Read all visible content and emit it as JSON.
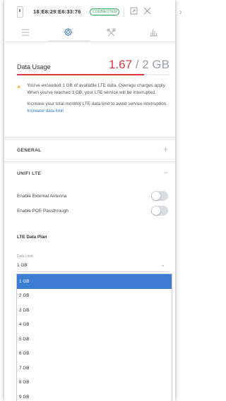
{
  "device": {
    "mac": "18:E8:29:E6:33:76",
    "status": "CONNECTED"
  },
  "tabs": [
    {
      "name": "list",
      "icon": "list-icon"
    },
    {
      "name": "settings",
      "icon": "gear-icon",
      "active": true
    },
    {
      "name": "tools",
      "icon": "tools-icon"
    },
    {
      "name": "statistics",
      "icon": "bar-chart-icon"
    }
  ],
  "usage": {
    "label": "Data Usage",
    "used": "1.67",
    "separator": "/",
    "limit": "2 GB",
    "fraction": 0.835,
    "warning_main": "You've exceeded 1 GB of available LTE data. Overage charges apply. When you've reached 3 GB, your LTE service will be interrupted.",
    "warning_second": "Increase your total monthly LTE data limit to avoid service interruption.",
    "warning_link": "Increase data limit"
  },
  "sections": {
    "general": {
      "title": "GENERAL",
      "toggle": "+"
    },
    "unifi_lte": {
      "title": "UNIFI LTE",
      "toggle": "−"
    }
  },
  "lte": {
    "external_antenna_label": "Enable External Antenna",
    "poe_passthrough_label": "Enable POE Passthrough",
    "plan_title": "LTE Data Plan",
    "data_limit_label": "Data Limit",
    "selected_value": "1 GB",
    "options": [
      "1 GB",
      "2 GB",
      "3 GB",
      "4 GB",
      "5 GB",
      "6 GB",
      "7 GB",
      "8 GB",
      "9 GB"
    ]
  },
  "colors": {
    "accent_red": "#e03744",
    "link_blue": "#2b7fce",
    "selected_blue": "#3d7cd3",
    "warning_orange": "#f0a020",
    "connected_green": "#2ca05a"
  }
}
